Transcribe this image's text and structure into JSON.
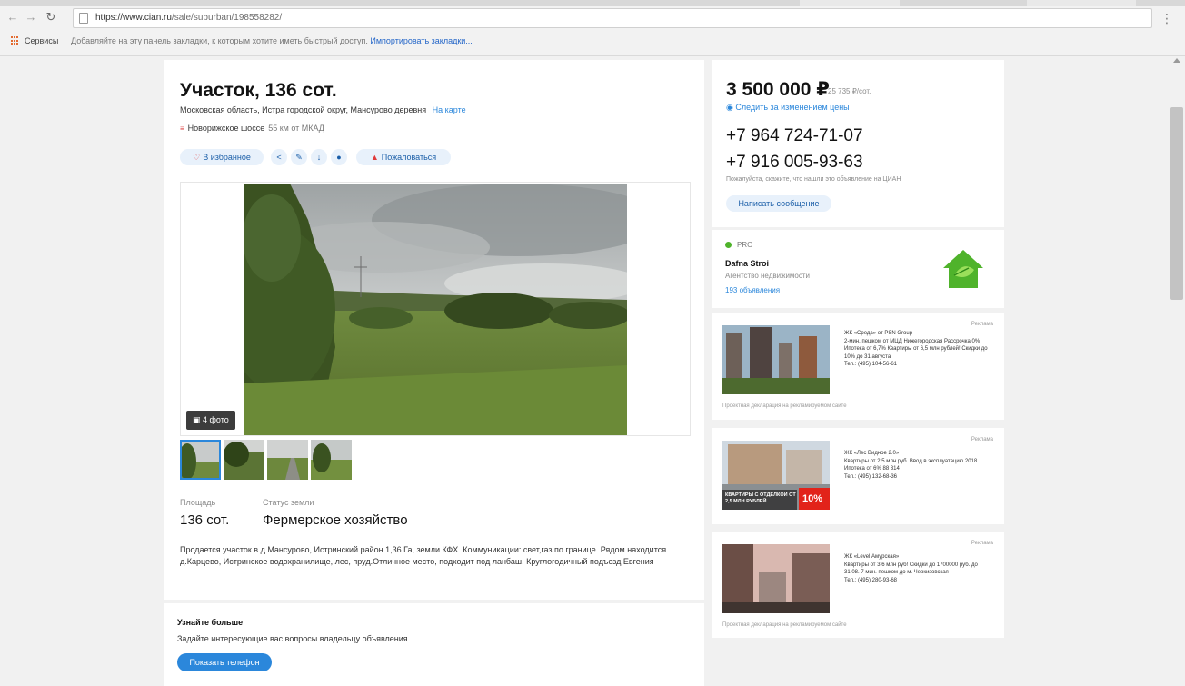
{
  "browser": {
    "url_host": "https://www.cian.ru",
    "url_path": "/sale/suburban/198558282/",
    "bookmarks_apps": "Сервисы",
    "bookmarks_hint": "Добавляйте на эту панель закладки, к которым хотите иметь быстрый доступ.",
    "bookmarks_import": "Импортировать закладки..."
  },
  "listing": {
    "title": "Участок, 136 сот.",
    "address": "Московская область, Истра городской округ, Мансурово деревня",
    "map_link": "На карте",
    "highway": "Новорижское шоссе",
    "distance": "55 км от МКАД",
    "actions": {
      "favorite": "В избранное",
      "complain": "Пожаловаться"
    },
    "photo_count": "4 фото",
    "params": [
      {
        "label": "Площадь",
        "value": "136 сот."
      },
      {
        "label": "Статус земли",
        "value": "Фермерское хозяйство"
      }
    ],
    "description": "Продается участок в д.Мансурово, Истринский район 1,36 Га, земли КФХ. Коммуникации: свет,газ по границе. Рядом находится д.Карцево, Истринское водохранилище, лес, пруд.Отличное место, подходит под ланбаш. Круглогодичный подъезд Евгения"
  },
  "contact_more": {
    "title": "Узнайте больше",
    "text": "Задайте интересующие вас вопросы владельцу объявления",
    "button": "Показать телефон"
  },
  "sidebar": {
    "price": "3 500 000 ₽",
    "price_per_unit": "25 735 ₽/сот.",
    "watch_price": "Следить за изменением цены",
    "phones": [
      "+7 964 724-71-07",
      "+7 916 005-93-63"
    ],
    "phone_note": "Пожалуйста, скажите, что нашли это объявление на ЦИАН",
    "message_button": "Написать сообщение",
    "agent": {
      "badge": "PRO",
      "name": "Dafna Stroi",
      "type": "Агентство недвижимости",
      "listings": "193 объявления"
    }
  },
  "ads": [
    {
      "label": "Реклама",
      "name": "ЖК «Среда» от PSN Group",
      "text": "2-мин. пешком от МЦД Нижегородская Рассрочка 0% Ипотека от 6,7% Квартиры от 6,5 млн рублей! Скидки до 10% до 31 августа",
      "phone": "Тел.: (495) 104-56-61",
      "footer": "Проектная декларация на рекламируемом сайте"
    },
    {
      "label": "Реклама",
      "name": "ЖК «Лес Видное 2.0»",
      "text": "Квартиры от 2,5 млн руб. Ввод в эксплуатацию 2018. Ипотека от 6% 88 314",
      "phone": "Тел.: (495) 132-68-36",
      "banner_text": "КВАРТИРЫ С ОТДЕЛКОЙ ОТ 2,5 МЛН РУБЛЕЙ",
      "banner_badge": "10%"
    },
    {
      "label": "Реклама",
      "name": "ЖК «Level Амурская»",
      "text": "Квартиры от 3,6 млн руб! Скидки до 1700000 руб. до 31.08. 7 мин. пешком до м. Черкизовская",
      "phone": "Тел.: (495) 280-93-68",
      "footer": "Проектная декларация на рекламируемом сайте"
    }
  ],
  "colors": {
    "accent": "#2b87db",
    "pill_bg": "#e8f1fb",
    "page_bg": "#f1f1f1",
    "favorite_icon": "#e03b3b",
    "pro_dot": "#4fb32b",
    "agent_logo": "#4fb32b"
  }
}
